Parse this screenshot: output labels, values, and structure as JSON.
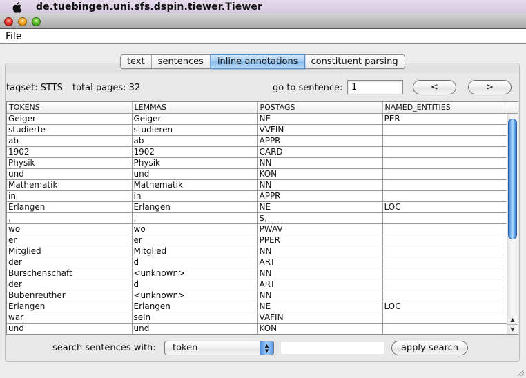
{
  "system_menubar": {
    "apple_icon": "apple-icon",
    "app_title": "de.tuebingen.uni.sfs.dspin.tiewer.Tiewer"
  },
  "window": {
    "controls": [
      "close",
      "minimize",
      "zoom"
    ]
  },
  "menu": {
    "items": [
      {
        "label": "File"
      }
    ]
  },
  "tabs": [
    {
      "label": "text",
      "active": false
    },
    {
      "label": "sentences",
      "active": false
    },
    {
      "label": "inline annotations",
      "active": true
    },
    {
      "label": "constituent parsing",
      "active": false
    }
  ],
  "info": {
    "tagset": "tagset: STTS",
    "total_pages": "total pages: 32"
  },
  "navigation": {
    "goto_label": "go to sentence:",
    "goto_value": "1",
    "prev_label": "<",
    "next_label": ">"
  },
  "table": {
    "columns": [
      "TOKENS",
      "LEMMAS",
      "POSTAGS",
      "NAMED_ENTITIES"
    ],
    "rows": [
      [
        "Geiger",
        "Geiger",
        "NE",
        "PER"
      ],
      [
        "studierte",
        "studieren",
        "VVFIN",
        ""
      ],
      [
        "ab",
        "ab",
        "APPR",
        ""
      ],
      [
        "1902",
        "1902",
        "CARD",
        ""
      ],
      [
        "Physik",
        "Physik",
        "NN",
        ""
      ],
      [
        "und",
        "und",
        "KON",
        ""
      ],
      [
        "Mathematik",
        "Mathematik",
        "NN",
        ""
      ],
      [
        "in",
        "in",
        "APPR",
        ""
      ],
      [
        "Erlangen",
        "Erlangen",
        "NE",
        "LOC"
      ],
      [
        ",",
        ",",
        "$,",
        ""
      ],
      [
        "wo",
        "wo",
        "PWAV",
        ""
      ],
      [
        "er",
        "er",
        "PPER",
        ""
      ],
      [
        "Mitglied",
        "Mitglied",
        "NN",
        ""
      ],
      [
        "der",
        "d",
        "ART",
        ""
      ],
      [
        "Burschenschaft",
        "<unknown>",
        "NN",
        ""
      ],
      [
        "der",
        "d",
        "ART",
        ""
      ],
      [
        "Bubenreuther",
        "<unknown>",
        "NN",
        ""
      ],
      [
        "Erlangen",
        "Erlangen",
        "NE",
        "LOC"
      ],
      [
        "war",
        "sein",
        "VAFIN",
        ""
      ],
      [
        "und",
        "und",
        "KON",
        ""
      ]
    ]
  },
  "search": {
    "label": "search sentences with:",
    "select_value": "token",
    "input_value": "",
    "apply_label": "apply search"
  },
  "colors": {
    "accent": "#86bbef",
    "panel_bg": "#ececec"
  }
}
